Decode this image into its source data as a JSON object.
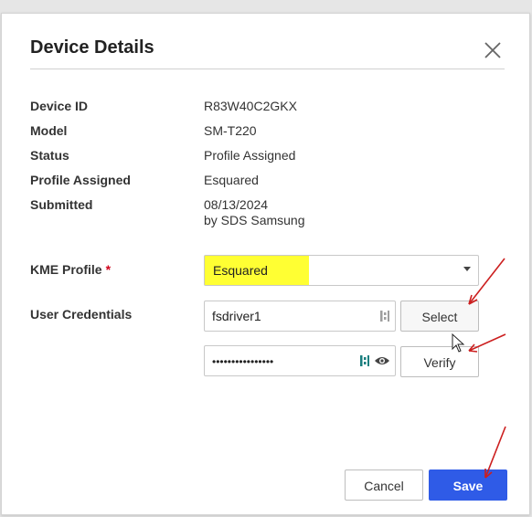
{
  "dialog": {
    "title": "Device Details",
    "close_icon": "close-icon"
  },
  "details": [
    {
      "label": "Device ID",
      "value": "R83W40C2GKX"
    },
    {
      "label": "Model",
      "value": "SM-T220"
    },
    {
      "label": "Status",
      "value": "Profile Assigned"
    },
    {
      "label": "Profile Assigned",
      "value": "Esquared"
    },
    {
      "label": "Submitted",
      "value": "08/13/2024",
      "value2": "by SDS Samsung"
    }
  ],
  "kme_profile": {
    "label": "KME Profile",
    "required_mark": "*",
    "selected": "Esquared",
    "highlight_color": "#ffff33"
  },
  "user_credentials": {
    "label": "User Credentials",
    "username": "fsdriver1",
    "password": "••••••••••••••••",
    "select_label": "Select",
    "verify_label": "Verify"
  },
  "footer": {
    "cancel_label": "Cancel",
    "save_label": "Save"
  },
  "colors": {
    "primary": "#2f5be7",
    "required": "#d0021b",
    "annotation_arrow": "#cc1f1f",
    "keeper_icon": "#1a7f7f"
  }
}
